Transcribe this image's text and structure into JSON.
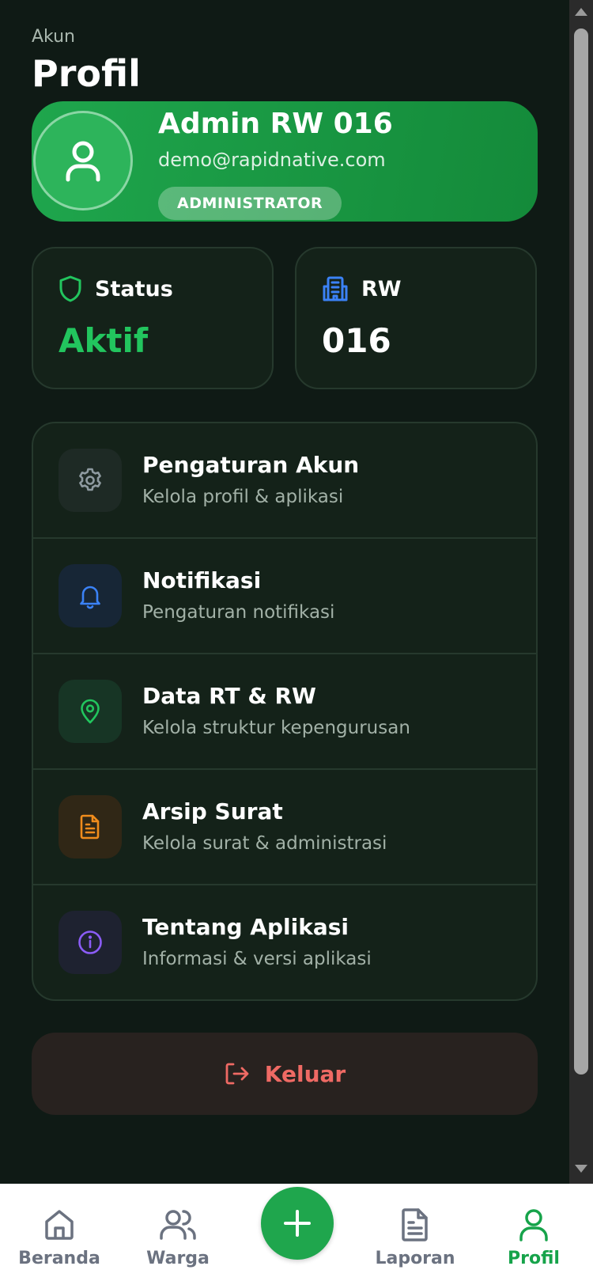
{
  "header": {
    "eyebrow": "Akun",
    "title": "Profil"
  },
  "profile": {
    "name": "Admin RW 016",
    "email": "demo@rapidnative.com",
    "role": "ADMINISTRATOR",
    "avatar_icon": "user-icon"
  },
  "stats": [
    {
      "label": "Status",
      "value": "Aktif",
      "icon": "shield-icon",
      "value_color": "#22c55e"
    },
    {
      "label": "RW",
      "value": "016",
      "icon": "building-icon",
      "value_color": "#ffffff"
    }
  ],
  "menu": [
    {
      "title": "Pengaturan Akun",
      "subtitle": "Kelola profil & aplikasi",
      "icon": "gear-icon",
      "color": "#8e9aa0"
    },
    {
      "title": "Notifikasi",
      "subtitle": "Pengaturan notifikasi",
      "icon": "bell-icon",
      "color": "#3b82f6"
    },
    {
      "title": "Data RT & RW",
      "subtitle": "Kelola struktur kepengurusan",
      "icon": "map-pin-icon",
      "color": "#22c55e"
    },
    {
      "title": "Arsip Surat",
      "subtitle": "Kelola surat & administrasi",
      "icon": "document-icon",
      "color": "#f08c1c"
    },
    {
      "title": "Tentang Aplikasi",
      "subtitle": "Informasi & versi aplikasi",
      "icon": "info-icon",
      "color": "#8b5cf6"
    }
  ],
  "logout": {
    "label": "Keluar",
    "icon": "logout-icon",
    "color": "#ef6a64"
  },
  "tabs": [
    {
      "label": "Beranda",
      "icon": "home-icon",
      "active": false
    },
    {
      "label": "Warga",
      "icon": "users-icon",
      "active": false
    },
    {
      "label": "",
      "icon": "plus-icon",
      "active": false
    },
    {
      "label": "Laporan",
      "icon": "report-icon",
      "active": false
    },
    {
      "label": "Profil",
      "icon": "user-icon",
      "active": true
    }
  ],
  "colors": {
    "accent": "#16a34a",
    "background": "#0f1a15",
    "card": "#142219"
  }
}
